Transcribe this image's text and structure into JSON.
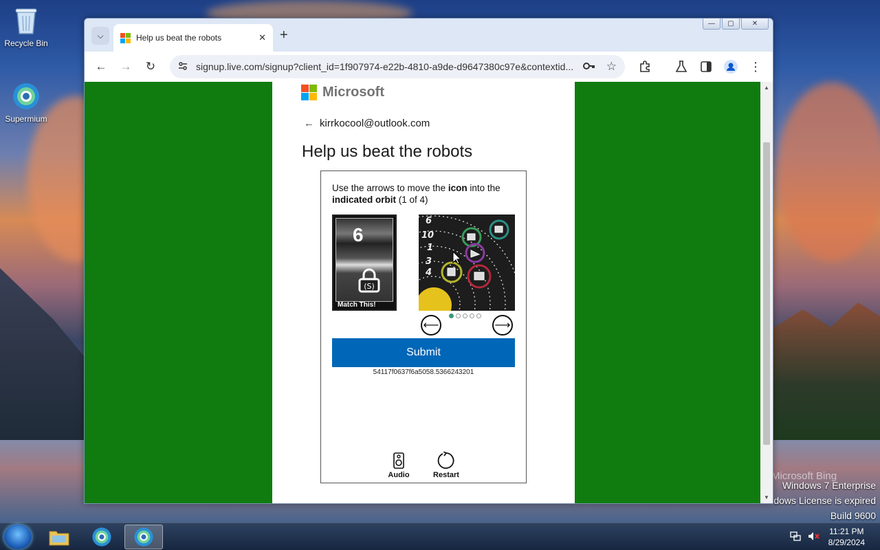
{
  "desktop": {
    "icons": [
      {
        "label": "Recycle Bin",
        "icon": "recycle-bin-icon"
      },
      {
        "label": "Supermium",
        "icon": "supermium-icon"
      }
    ],
    "watermark": {
      "brand": "Microsoft Bing",
      "line1": "Windows 7 Enterprise",
      "line2": "dows License is expired",
      "line3": "Build 9600"
    }
  },
  "taskbar": {
    "time": "11:21 PM",
    "date": "8/29/2024",
    "apps": [
      "start-orb-icon",
      "file-explorer-icon",
      "supermium-icon",
      "supermium-active-icon"
    ]
  },
  "browser": {
    "tab_title": "Help us beat the robots",
    "url": "signup.live.com/signup?client_id=1f907974-e22b-4810-a9de-d9647380c97e&contextid...",
    "colors": {
      "page_bg": "#107c10",
      "submit": "#0067b8"
    }
  },
  "page": {
    "brand": "Microsoft",
    "email": "kirrkocool@outlook.com",
    "heading": "Help us beat the robots",
    "captcha": {
      "instr_part1": "Use the arrows to move the ",
      "instr_bold1": "icon",
      "instr_part2": " into the ",
      "instr_bold2": "indicated orbit",
      "instr_part3": " (1 of 4)",
      "target_number": "6",
      "match_label": "Match This!",
      "orbit_numbers": [
        "6",
        "10",
        "1",
        "3",
        "4"
      ],
      "pager_total": 5,
      "pager_active": 1,
      "submit_label": "Submit",
      "session_id": "54117f0637f6a5058.5366243201",
      "audio_label": "Audio",
      "restart_label": "Restart"
    }
  }
}
